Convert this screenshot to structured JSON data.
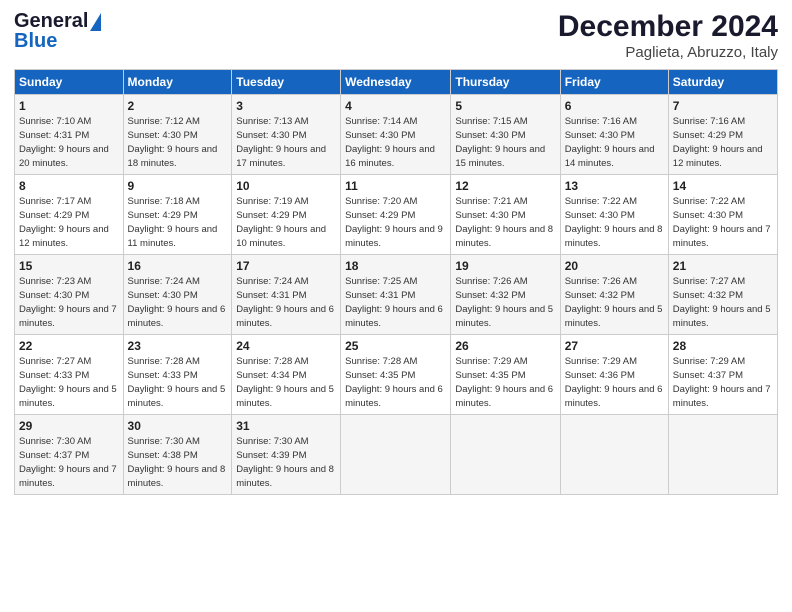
{
  "logo": {
    "line1": "General",
    "line2": "Blue"
  },
  "title": "December 2024",
  "subtitle": "Paglieta, Abruzzo, Italy",
  "days_of_week": [
    "Sunday",
    "Monday",
    "Tuesday",
    "Wednesday",
    "Thursday",
    "Friday",
    "Saturday"
  ],
  "weeks": [
    [
      {
        "day": 1,
        "sunrise": "7:10 AM",
        "sunset": "4:31 PM",
        "daylight": "9 hours and 20 minutes."
      },
      {
        "day": 2,
        "sunrise": "7:12 AM",
        "sunset": "4:30 PM",
        "daylight": "9 hours and 18 minutes."
      },
      {
        "day": 3,
        "sunrise": "7:13 AM",
        "sunset": "4:30 PM",
        "daylight": "9 hours and 17 minutes."
      },
      {
        "day": 4,
        "sunrise": "7:14 AM",
        "sunset": "4:30 PM",
        "daylight": "9 hours and 16 minutes."
      },
      {
        "day": 5,
        "sunrise": "7:15 AM",
        "sunset": "4:30 PM",
        "daylight": "9 hours and 15 minutes."
      },
      {
        "day": 6,
        "sunrise": "7:16 AM",
        "sunset": "4:30 PM",
        "daylight": "9 hours and 14 minutes."
      },
      {
        "day": 7,
        "sunrise": "7:16 AM",
        "sunset": "4:29 PM",
        "daylight": "9 hours and 12 minutes."
      }
    ],
    [
      {
        "day": 8,
        "sunrise": "7:17 AM",
        "sunset": "4:29 PM",
        "daylight": "9 hours and 12 minutes."
      },
      {
        "day": 9,
        "sunrise": "7:18 AM",
        "sunset": "4:29 PM",
        "daylight": "9 hours and 11 minutes."
      },
      {
        "day": 10,
        "sunrise": "7:19 AM",
        "sunset": "4:29 PM",
        "daylight": "9 hours and 10 minutes."
      },
      {
        "day": 11,
        "sunrise": "7:20 AM",
        "sunset": "4:29 PM",
        "daylight": "9 hours and 9 minutes."
      },
      {
        "day": 12,
        "sunrise": "7:21 AM",
        "sunset": "4:30 PM",
        "daylight": "9 hours and 8 minutes."
      },
      {
        "day": 13,
        "sunrise": "7:22 AM",
        "sunset": "4:30 PM",
        "daylight": "9 hours and 8 minutes."
      },
      {
        "day": 14,
        "sunrise": "7:22 AM",
        "sunset": "4:30 PM",
        "daylight": "9 hours and 7 minutes."
      }
    ],
    [
      {
        "day": 15,
        "sunrise": "7:23 AM",
        "sunset": "4:30 PM",
        "daylight": "9 hours and 7 minutes."
      },
      {
        "day": 16,
        "sunrise": "7:24 AM",
        "sunset": "4:30 PM",
        "daylight": "9 hours and 6 minutes."
      },
      {
        "day": 17,
        "sunrise": "7:24 AM",
        "sunset": "4:31 PM",
        "daylight": "9 hours and 6 minutes."
      },
      {
        "day": 18,
        "sunrise": "7:25 AM",
        "sunset": "4:31 PM",
        "daylight": "9 hours and 6 minutes."
      },
      {
        "day": 19,
        "sunrise": "7:26 AM",
        "sunset": "4:32 PM",
        "daylight": "9 hours and 5 minutes."
      },
      {
        "day": 20,
        "sunrise": "7:26 AM",
        "sunset": "4:32 PM",
        "daylight": "9 hours and 5 minutes."
      },
      {
        "day": 21,
        "sunrise": "7:27 AM",
        "sunset": "4:32 PM",
        "daylight": "9 hours and 5 minutes."
      }
    ],
    [
      {
        "day": 22,
        "sunrise": "7:27 AM",
        "sunset": "4:33 PM",
        "daylight": "9 hours and 5 minutes."
      },
      {
        "day": 23,
        "sunrise": "7:28 AM",
        "sunset": "4:33 PM",
        "daylight": "9 hours and 5 minutes."
      },
      {
        "day": 24,
        "sunrise": "7:28 AM",
        "sunset": "4:34 PM",
        "daylight": "9 hours and 5 minutes."
      },
      {
        "day": 25,
        "sunrise": "7:28 AM",
        "sunset": "4:35 PM",
        "daylight": "9 hours and 6 minutes."
      },
      {
        "day": 26,
        "sunrise": "7:29 AM",
        "sunset": "4:35 PM",
        "daylight": "9 hours and 6 minutes."
      },
      {
        "day": 27,
        "sunrise": "7:29 AM",
        "sunset": "4:36 PM",
        "daylight": "9 hours and 6 minutes."
      },
      {
        "day": 28,
        "sunrise": "7:29 AM",
        "sunset": "4:37 PM",
        "daylight": "9 hours and 7 minutes."
      }
    ],
    [
      {
        "day": 29,
        "sunrise": "7:30 AM",
        "sunset": "4:37 PM",
        "daylight": "9 hours and 7 minutes."
      },
      {
        "day": 30,
        "sunrise": "7:30 AM",
        "sunset": "4:38 PM",
        "daylight": "9 hours and 8 minutes."
      },
      {
        "day": 31,
        "sunrise": "7:30 AM",
        "sunset": "4:39 PM",
        "daylight": "9 hours and 8 minutes."
      },
      null,
      null,
      null,
      null
    ]
  ]
}
